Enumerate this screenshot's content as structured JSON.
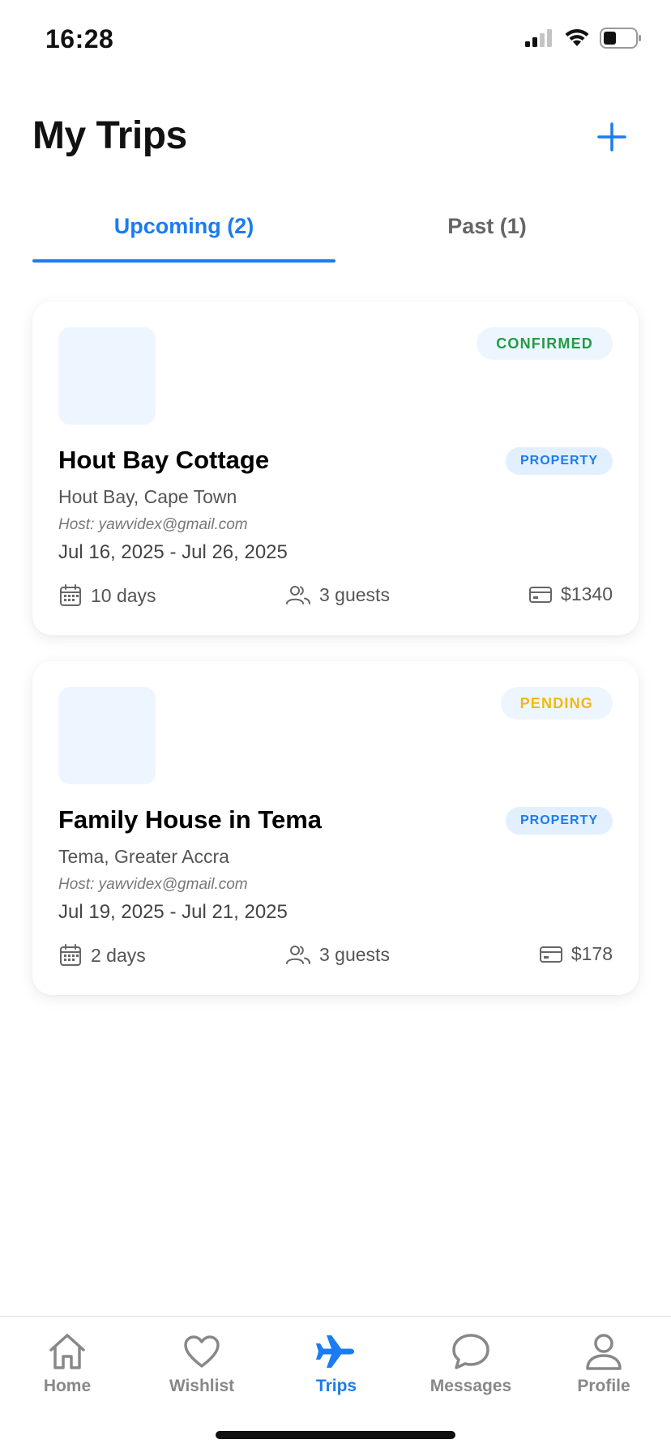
{
  "status_bar": {
    "time": "16:28"
  },
  "header": {
    "title": "My Trips",
    "add_icon": "plus-icon"
  },
  "tabs": [
    {
      "label": "Upcoming (2)",
      "active": true
    },
    {
      "label": "Past (1)",
      "active": false
    }
  ],
  "trips": [
    {
      "status": "CONFIRMED",
      "status_color": "#1f9d46",
      "type": "PROPERTY",
      "title": "Hout Bay Cottage",
      "location": "Hout Bay, Cape Town",
      "host": "Host: yawvidex@gmail.com",
      "dates": "Jul 16, 2025 - Jul 26, 2025",
      "duration": "10 days",
      "guests": "3 guests",
      "price": "$1340"
    },
    {
      "status": "PENDING",
      "status_color": "#f2b90a",
      "type": "PROPERTY",
      "title": "Family House in Tema",
      "location": "Tema, Greater Accra",
      "host": "Host: yawvidex@gmail.com",
      "dates": "Jul 19, 2025 - Jul 21, 2025",
      "duration": "2 days",
      "guests": "3 guests",
      "price": "$178"
    }
  ],
  "tabbar": [
    {
      "label": "Home",
      "icon": "home-icon"
    },
    {
      "label": "Wishlist",
      "icon": "heart-icon"
    },
    {
      "label": "Trips",
      "icon": "airplane-icon",
      "active": true
    },
    {
      "label": "Messages",
      "icon": "chat-bubble-icon"
    },
    {
      "label": "Profile",
      "icon": "person-icon"
    }
  ],
  "colors": {
    "accent": "#1a7cf0",
    "confirmed": "#1f9d46",
    "pending": "#f2b90a"
  }
}
